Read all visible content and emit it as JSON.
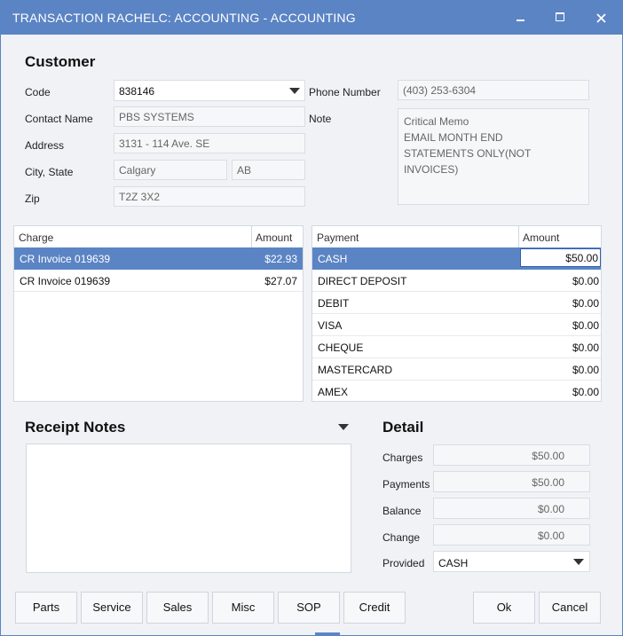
{
  "window": {
    "title": "TRANSACTION RACHELC: ACCOUNTING - ACCOUNTING"
  },
  "customer": {
    "heading": "Customer",
    "code_label": "Code",
    "code": "838146",
    "contact_label": "Contact Name",
    "contact": "PBS SYSTEMS",
    "address_label": "Address",
    "address": "3131 - 114 Ave. SE",
    "city_state_label": "City, State",
    "city": "Calgary",
    "state": "AB",
    "zip_label": "Zip",
    "zip": "T2Z 3X2",
    "phone_label": "Phone Number",
    "phone": "(403) 253-6304",
    "note_label": "Note",
    "note_lines": [
      "Critical Memo",
      "EMAIL MONTH END",
      "STATEMENTS ONLY(NOT",
      "INVOICES)"
    ]
  },
  "charges": {
    "col_charge": "Charge",
    "col_amount": "Amount",
    "rows": [
      {
        "charge": "CR Invoice 019639",
        "amount": "$22.93"
      },
      {
        "charge": "CR Invoice 019639",
        "amount": "$27.07"
      }
    ]
  },
  "payments": {
    "col_payment": "Payment",
    "col_amount": "Amount",
    "rows": [
      {
        "payment": "CASH",
        "amount": "$50.00"
      },
      {
        "payment": "DIRECT DEPOSIT",
        "amount": "$0.00"
      },
      {
        "payment": "DEBIT",
        "amount": "$0.00"
      },
      {
        "payment": "VISA",
        "amount": "$0.00"
      },
      {
        "payment": "CHEQUE",
        "amount": "$0.00"
      },
      {
        "payment": "MASTERCARD",
        "amount": "$0.00"
      },
      {
        "payment": "AMEX",
        "amount": "$0.00"
      }
    ]
  },
  "receipt_notes": {
    "heading": "Receipt Notes"
  },
  "detail": {
    "heading": "Detail",
    "charges_label": "Charges",
    "charges": "$50.00",
    "payments_label": "Payments",
    "payments": "$50.00",
    "balance_label": "Balance",
    "balance": "$0.00",
    "change_label": "Change",
    "change": "$0.00",
    "provided_label": "Provided",
    "provided": "CASH"
  },
  "buttons": {
    "parts": "Parts",
    "service": "Service",
    "sales": "Sales",
    "misc": "Misc",
    "sop": "SOP",
    "credit": "Credit",
    "ok": "Ok",
    "cancel": "Cancel"
  },
  "colors": {
    "accent": "#5b84c4",
    "selection": "#5b84c4"
  },
  "icons": [
    "minimize-icon",
    "maximize-icon",
    "close-icon",
    "dropdown-arrow-icon"
  ]
}
